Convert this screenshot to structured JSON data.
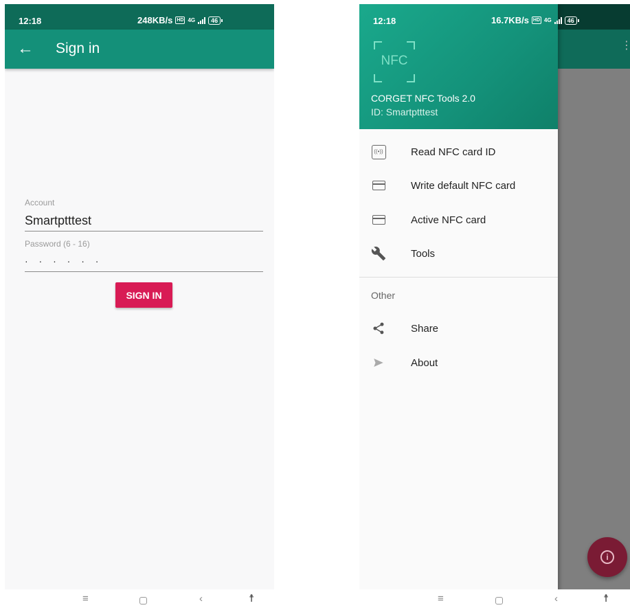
{
  "left_screen": {
    "status": {
      "time": "12:18",
      "speed": "248KB/s",
      "hd": "HD",
      "network": "4G",
      "battery": "46"
    },
    "app_bar": {
      "title": "Sign in"
    },
    "form": {
      "account_label": "Account",
      "account_value": "Smartptttest",
      "password_label": "Password (6 - 16)",
      "password_value": "· · · · · ·",
      "submit_label": "SIGN IN"
    }
  },
  "right_screen": {
    "status": {
      "time": "12:18",
      "speed": "16.7KB/s",
      "hd": "HD",
      "network": "4G",
      "battery": "46"
    },
    "drawer": {
      "logo_text": "NFC",
      "title": "CORGET NFC Tools 2.0",
      "subtitle": "ID: Smartptttest",
      "items": [
        {
          "label": "Read NFC card ID",
          "icon": "nfc-read-icon"
        },
        {
          "label": "Write default NFC card",
          "icon": "card-write-icon"
        },
        {
          "label": "Active NFC card",
          "icon": "card-active-icon"
        },
        {
          "label": "Tools",
          "icon": "wrench-icon"
        }
      ],
      "section_label": "Other",
      "other_items": [
        {
          "label": "Share",
          "icon": "share-icon"
        },
        {
          "label": "About",
          "icon": "send-icon"
        }
      ]
    }
  },
  "colors": {
    "primary": "#149079",
    "primary_dark": "#0e6b58",
    "accent": "#d81b55"
  }
}
